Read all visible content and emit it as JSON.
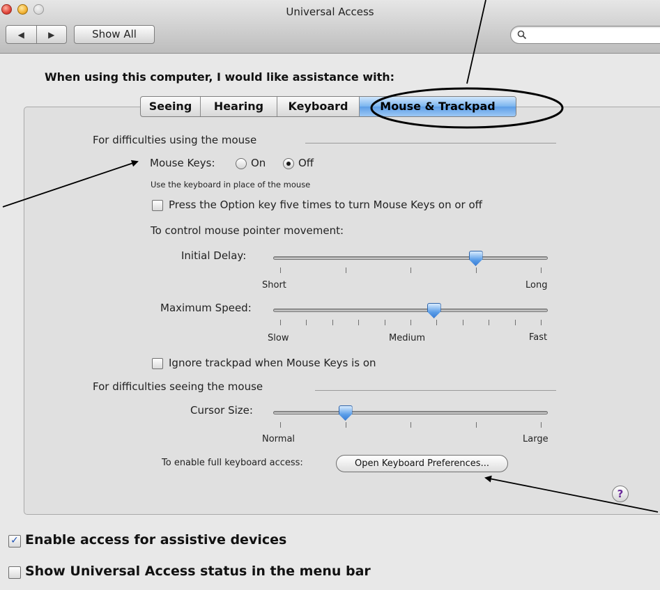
{
  "window": {
    "title": "Universal Access",
    "show_all_label": "Show All",
    "back_glyph": "◀",
    "forward_glyph": "▶",
    "search": {
      "placeholder": "",
      "icon": "magnifier-icon"
    }
  },
  "headline": "When using this computer, I would like assistance with:",
  "tabs": [
    {
      "label": "Seeing",
      "selected": false
    },
    {
      "label": "Hearing",
      "selected": false
    },
    {
      "label": "Keyboard",
      "selected": false
    },
    {
      "label": "Mouse & Trackpad",
      "selected": true
    }
  ],
  "mouse_section": {
    "heading": "For difficulties using the mouse",
    "mouse_keys_label": "Mouse Keys:",
    "on_label": "On",
    "off_label": "Off",
    "selected": "Off",
    "hint": "Use the keyboard in place of the mouse",
    "option_key_label": "Press the Option key five times to turn Mouse Keys on or off",
    "option_key_checked": false,
    "control_heading": "To control mouse pointer movement:",
    "initial_delay": {
      "label": "Initial Delay:",
      "min_label": "Short",
      "max_label": "Long",
      "value": 0.75,
      "ticks": 5
    },
    "maximum_speed": {
      "label": "Maximum Speed:",
      "min_label": "Slow",
      "mid_label": "Medium",
      "max_label": "Fast",
      "value": 0.59,
      "ticks": 11
    },
    "ignore_trackpad_label": "Ignore trackpad when Mouse Keys is on",
    "ignore_trackpad_checked": false
  },
  "seeing_section": {
    "heading": "For difficulties seeing the mouse",
    "cursor_size": {
      "label": "Cursor Size:",
      "min_label": "Normal",
      "max_label": "Large",
      "value": 0.25,
      "ticks": 5
    }
  },
  "keyboard_access": {
    "label": "To enable full keyboard access:",
    "button_label": "Open Keyboard Preferences..."
  },
  "help_glyph": "?",
  "bottom": {
    "assistive_label": "Enable access for assistive devices",
    "assistive_checked": true,
    "menu_bar_label": "Show Universal Access status in the menu bar",
    "menu_bar_checked": false,
    "check_glyph": "✓"
  }
}
